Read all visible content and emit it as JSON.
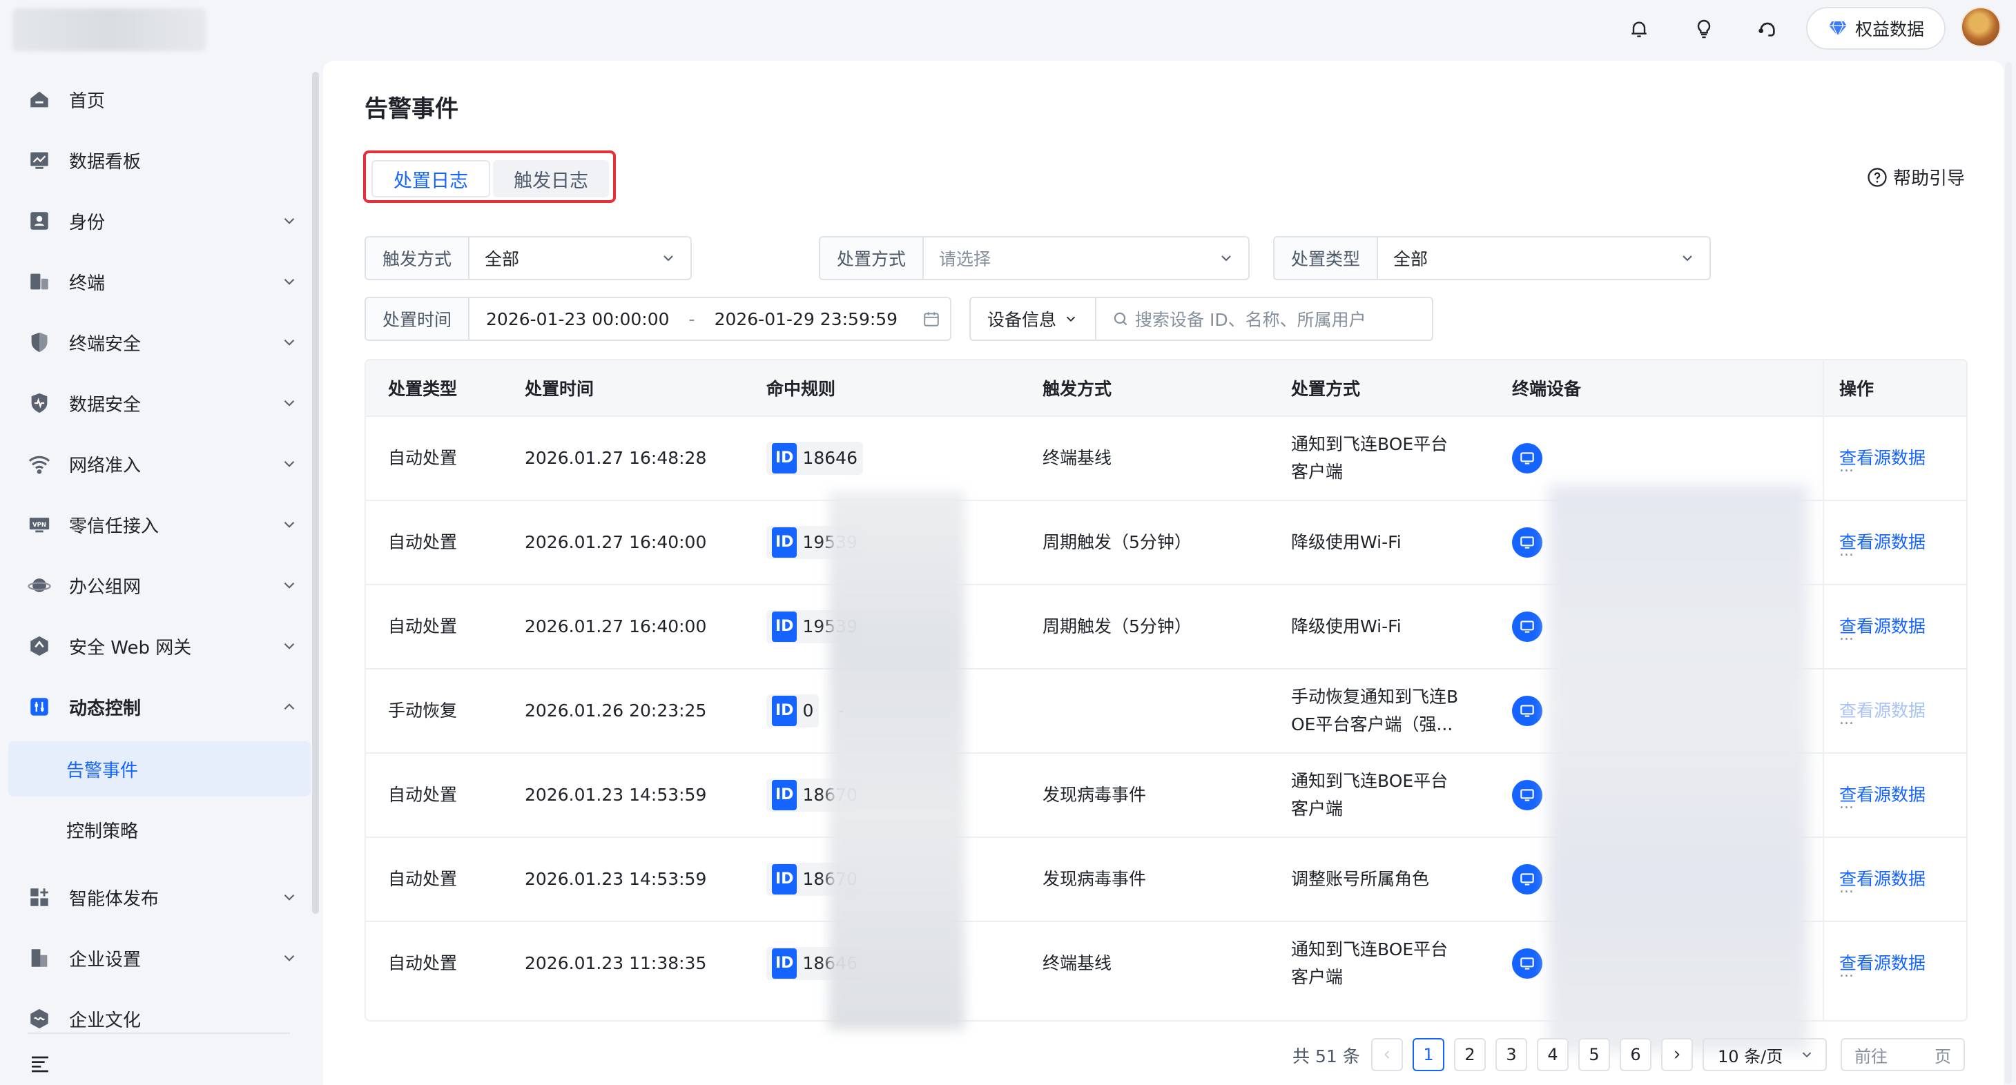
{
  "topbar": {
    "benefit_label": "权益数据"
  },
  "sidebar": {
    "items": [
      {
        "label": "首页",
        "icon": "home-icon"
      },
      {
        "label": "数据看板",
        "icon": "dashboard-icon"
      },
      {
        "label": "身份",
        "icon": "identity-icon"
      },
      {
        "label": "终端",
        "icon": "terminal-icon"
      },
      {
        "label": "终端安全",
        "icon": "shield-icon"
      },
      {
        "label": "数据安全",
        "icon": "data-shield-icon"
      },
      {
        "label": "网络准入",
        "icon": "wifi-icon"
      },
      {
        "label": "零信任接入",
        "icon": "vpn-icon"
      },
      {
        "label": "办公组网",
        "icon": "planet-icon"
      },
      {
        "label": "安全 Web 网关",
        "icon": "gateway-icon"
      },
      {
        "label": "动态控制",
        "icon": "dynamic-control-icon"
      }
    ],
    "sub_items": [
      {
        "label": "告警事件"
      },
      {
        "label": "控制策略"
      }
    ],
    "items_after": [
      {
        "label": "智能体发布",
        "icon": "agent-icon"
      },
      {
        "label": "企业设置",
        "icon": "building-icon"
      },
      {
        "label": "企业文化",
        "icon": "culture-icon"
      }
    ]
  },
  "main": {
    "title": "告警事件",
    "tabs": [
      {
        "label": "处置日志"
      },
      {
        "label": "触发日志"
      }
    ],
    "help_label": "帮助引导",
    "filters": {
      "trigger_method": {
        "label": "触发方式",
        "value": "全部"
      },
      "handle_method": {
        "label": "处置方式",
        "placeholder": "请选择"
      },
      "handle_type": {
        "label": "处置类型",
        "value": "全部"
      },
      "handle_time": {
        "label": "处置时间",
        "start": "2026-01-23 00:00:00",
        "sep": "-",
        "end": "2026-01-29 23:59:59"
      },
      "device_info": {
        "label": "设备信息",
        "placeholder": "搜索设备 ID、名称、所属用户"
      }
    },
    "table": {
      "headers": [
        "处置类型",
        "处置时间",
        "命中规则",
        "触发方式",
        "处置方式",
        "终端设备",
        "操作"
      ],
      "id_tag": "ID",
      "rows": [
        {
          "type": "自动处置",
          "time": "2026.01.27 16:48:28",
          "rule_id": "18646",
          "rule_extra": "",
          "trigger": "终端基线",
          "method_l1": "通知到飞连BOE平台",
          "method_l2": "客户端",
          "action": "查看源数据",
          "action_enabled": true
        },
        {
          "type": "自动处置",
          "time": "2026.01.27 16:40:00",
          "rule_id": "19539",
          "rule_extra": "",
          "trigger": "周期触发（5分钟）",
          "method_l1": "降级使用Wi-Fi",
          "method_l2": "",
          "action": "查看源数据",
          "action_enabled": true
        },
        {
          "type": "自动处置",
          "time": "2026.01.27 16:40:00",
          "rule_id": "19539",
          "rule_extra": "",
          "trigger": "周期触发（5分钟）",
          "method_l1": "降级使用Wi-Fi",
          "method_l2": "",
          "action": "查看源数据",
          "action_enabled": true
        },
        {
          "type": "手动恢复",
          "time": "2026.01.26 20:23:25",
          "rule_id": "0",
          "rule_extra": "-",
          "trigger": "",
          "method_l1": "手动恢复通知到飞连B",
          "method_l2": "OE平台客户端（强...",
          "action": "查看源数据",
          "action_enabled": false
        },
        {
          "type": "自动处置",
          "time": "2026.01.23 14:53:59",
          "rule_id": "18670",
          "rule_extra": "",
          "trigger": "发现病毒事件",
          "method_l1": "通知到飞连BOE平台",
          "method_l2": "客户端",
          "action": "查看源数据",
          "action_enabled": true
        },
        {
          "type": "自动处置",
          "time": "2026.01.23 14:53:59",
          "rule_id": "18670",
          "rule_extra": "",
          "trigger": "发现病毒事件",
          "method_l1": "调整账号所属角色",
          "method_l2": "",
          "action": "查看源数据",
          "action_enabled": true
        },
        {
          "type": "自动处置",
          "time": "2026.01.23 11:38:35",
          "rule_id": "18646",
          "rule_extra": "",
          "trigger": "终端基线",
          "method_l1": "通知到飞连BOE平台",
          "method_l2": "客户端",
          "action": "查看源数据",
          "action_enabled": true
        }
      ],
      "ellipsis": "..."
    },
    "pagination": {
      "total": "共 51 条",
      "pages": [
        "1",
        "2",
        "3",
        "4",
        "5",
        "6"
      ],
      "current": "1",
      "page_size": "10 条/页",
      "jump_prefix": "前往",
      "jump_suffix": "页"
    }
  }
}
